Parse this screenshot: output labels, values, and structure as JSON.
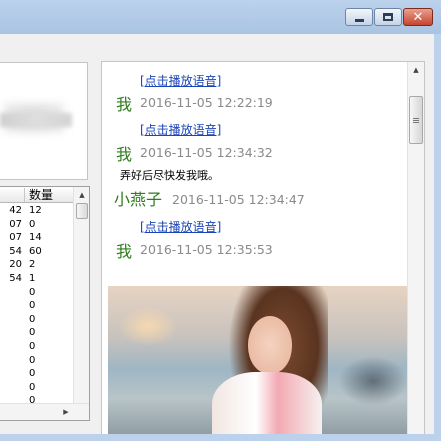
{
  "window": {
    "minimize_glyph": "",
    "maximize_glyph": "",
    "close_glyph": "✕"
  },
  "grid": {
    "header_label": "数量",
    "rows": [
      {
        "a": "42",
        "b": "12"
      },
      {
        "a": "07",
        "b": "0"
      },
      {
        "a": "07",
        "b": "14"
      },
      {
        "a": "54",
        "b": "60"
      },
      {
        "a": "20",
        "b": "2"
      },
      {
        "a": "54",
        "b": "1"
      },
      {
        "a": "",
        "b": "0"
      },
      {
        "a": "",
        "b": "0"
      },
      {
        "a": "",
        "b": "0"
      },
      {
        "a": "",
        "b": "0"
      },
      {
        "a": "",
        "b": "0"
      },
      {
        "a": "",
        "b": "0"
      },
      {
        "a": "",
        "b": "0"
      },
      {
        "a": "",
        "b": "0"
      },
      {
        "a": "",
        "b": "0"
      }
    ]
  },
  "chat": {
    "messages": [
      {
        "link": "[点击播放语音]",
        "sender": "我",
        "time": "2016-11-05 12:22:19"
      },
      {
        "link": "[点击播放语音]",
        "sender": "我",
        "time": "2016-11-05 12:34:32",
        "text": "弄好后尽快发我哦。"
      },
      {
        "sender": "小燕子",
        "time": "2016-11-05 12:34:47"
      },
      {
        "link": "[点击播放语音]",
        "sender": "我",
        "time": "2016-11-05 12:35:53"
      }
    ],
    "scrollbar_thumb_grip": "lll"
  }
}
